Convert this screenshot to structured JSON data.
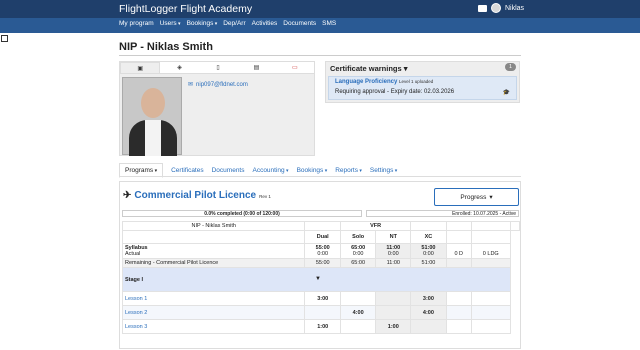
{
  "app": {
    "title": "FlightLogger Flight Academy",
    "user": "Niklas"
  },
  "nav": [
    {
      "label": "My program",
      "caret": false
    },
    {
      "label": "Users",
      "caret": true
    },
    {
      "label": "Bookings",
      "caret": true
    },
    {
      "label": "Dep/Arr",
      "caret": false
    },
    {
      "label": "Activities",
      "caret": false
    },
    {
      "label": "Documents",
      "caret": false
    },
    {
      "label": "SMS",
      "caret": false
    }
  ],
  "page": {
    "title": "NIP - Niklas Smith"
  },
  "profile": {
    "email": "nip097@fldnet.com",
    "tab_icons": [
      "id-card-icon",
      "tag-icon",
      "clipboard-icon",
      "chat-icon",
      "card-icon"
    ]
  },
  "certificates": {
    "title": "Certificate warnings",
    "count": "1",
    "item": {
      "name": "Language Proficiency",
      "note": "Level 1 uploaded",
      "status": "Requiring approval - Expiry date: 02.03.2026"
    }
  },
  "subnav": [
    {
      "label": "Programs",
      "caret": true,
      "active": true
    },
    {
      "label": "Certificates",
      "caret": false
    },
    {
      "label": "Documents",
      "caret": false
    },
    {
      "label": "Accounting",
      "caret": true
    },
    {
      "label": "Bookings",
      "caret": true
    },
    {
      "label": "Reports",
      "caret": true
    },
    {
      "label": "Settings",
      "caret": true
    }
  ],
  "program": {
    "title": "Commercial Pilot Licence",
    "rev": "Rev 1",
    "button": "Progress",
    "progress": "0.0% completed (0:00 of 120:00)",
    "enrolled": "Enrolled: 10.07.2025 - Active",
    "student": "NIP - Niklas Smith",
    "group": "VFR",
    "columns": [
      "Dual",
      "Solo",
      "NT",
      "XC"
    ],
    "syllabus": {
      "label": "Syllabus",
      "values": [
        "55:00",
        "65:00",
        "11:00",
        "51:00"
      ]
    },
    "actual": {
      "label": "Actual",
      "values": [
        "0:00",
        "0:00",
        "0:00",
        "0:00"
      ],
      "extra": [
        "0 D",
        "0 LDG"
      ]
    },
    "remaining": {
      "label": "Remaining - Commercial Pilot Licence",
      "values": [
        "55:00",
        "65:00",
        "11:00",
        "51:00"
      ]
    },
    "stage": "Stage I",
    "lessons": [
      {
        "label": "Lesson 1",
        "values": [
          "3:00",
          "",
          "",
          "3:00"
        ]
      },
      {
        "label": "Lesson 2",
        "values": [
          "",
          "4:00",
          "",
          "4:00"
        ]
      },
      {
        "label": "Lesson 3",
        "values": [
          "1:00",
          "",
          "1:00",
          ""
        ]
      }
    ]
  }
}
